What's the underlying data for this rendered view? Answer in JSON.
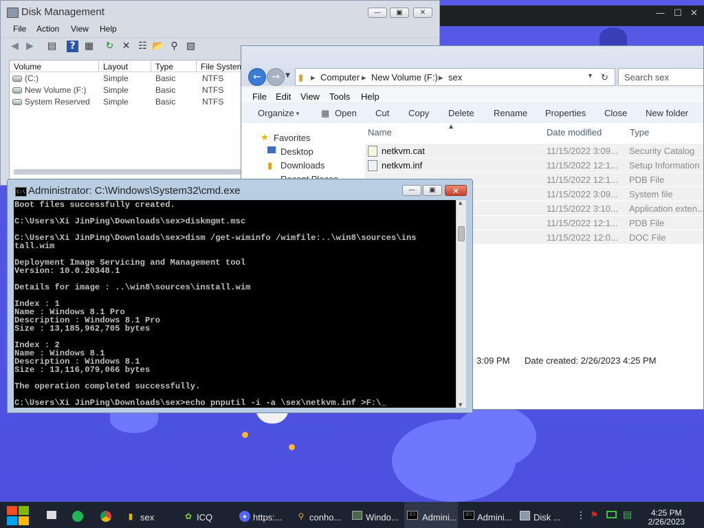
{
  "disk_management": {
    "title": "Disk Management",
    "menu": [
      "File",
      "Action",
      "View",
      "Help"
    ],
    "columns": [
      "Volume",
      "Layout",
      "Type",
      "File System"
    ],
    "volumes": [
      {
        "volume": "(C:)",
        "layout": "Simple",
        "type": "Basic",
        "fs": "NTFS"
      },
      {
        "volume": "New Volume (F:)",
        "layout": "Simple",
        "type": "Basic",
        "fs": "NTFS"
      },
      {
        "volume": "System Reserved",
        "layout": "Simple",
        "type": "Basic",
        "fs": "NTFS"
      }
    ],
    "toolbar_icons": [
      "back-icon",
      "forward-icon",
      "show-hide-icon",
      "help-icon",
      "properties-icon",
      "refresh-icon",
      "delete-icon",
      "properties-sheet-icon",
      "open-icon",
      "search-icon",
      "help-topics-icon"
    ]
  },
  "explorer": {
    "breadcrumb": [
      "Computer",
      "New Volume (F:)",
      "sex"
    ],
    "search_placeholder": "Search sex",
    "menu": [
      "File",
      "Edit",
      "View",
      "Tools",
      "Help"
    ],
    "commands": [
      "Organize",
      "Open",
      "Cut",
      "Copy",
      "Delete",
      "Rename",
      "Properties",
      "Close",
      "New folder"
    ],
    "nav": {
      "favorites": "Favorites",
      "items": [
        "Desktop",
        "Downloads",
        "Recent Places"
      ]
    },
    "columns": [
      "Name",
      "Date modified",
      "Type"
    ],
    "files": [
      {
        "name": "netkvm.cat",
        "date": "11/15/2022 3:09...",
        "type": "Security Catalog"
      },
      {
        "name": "netkvm.inf",
        "date": "11/15/2022 12:1...",
        "type": "Setup Information"
      },
      {
        "name": "",
        "date": "11/15/2022 12:1...",
        "type": "PDB File"
      },
      {
        "name": "",
        "date": "11/15/2022 3:09...",
        "type": "System file"
      },
      {
        "name": "",
        "date": "11/15/2022 3:10...",
        "type": "Application exten..."
      },
      {
        "name": "",
        "date": "11/15/2022 12:1...",
        "type": "PDB File"
      },
      {
        "name": "",
        "date": "11/15/2022 12:0...",
        "type": "DOC File"
      }
    ],
    "details_modified": "3:09 PM",
    "details_created": "Date created: 2/26/2023 4:25 PM"
  },
  "cmd": {
    "title": "Administrator: C:\\Windows\\System32\\cmd.exe",
    "output": "Boot files successfully created.\n\nC:\\Users\\Xi JinPing\\Downloads\\sex>diskmgmt.msc\n\nC:\\Users\\Xi JinPing\\Downloads\\sex>dism /get-wiminfo /wimfile:..\\win8\\sources\\ins\ntall.wim\n\nDeployment Image Servicing and Management tool\nVersion: 10.0.20348.1\n\nDetails for image : ..\\win8\\sources\\install.wim\n\nIndex : 1\nName : Windows 8.1 Pro\nDescription : Windows 8.1 Pro\nSize : 13,185,962,705 bytes\n\nIndex : 2\nName : Windows 8.1\nDescription : Windows 8.1\nSize : 13,116,079,066 bytes\n\nThe operation completed successfully.\n\nC:\\Users\\Xi JinPing\\Downloads\\sex>echo pnputil -i -a \\sex\\netkvm.inf >F:\\_"
  },
  "taskbar": {
    "items": [
      {
        "label": "sex",
        "icon": "folder-icon"
      },
      {
        "label": "ICQ",
        "icon": "icq-icon"
      },
      {
        "label": "https:...",
        "icon": "discord-icon"
      },
      {
        "label": "conho...",
        "icon": "search-icon"
      },
      {
        "label": "Windo...",
        "icon": "monitor-icon"
      },
      {
        "label": "Admini...",
        "icon": "cmd-icon"
      },
      {
        "label": "Admini...",
        "icon": "cmd-icon"
      },
      {
        "label": "Disk ...",
        "icon": "disk-icon"
      }
    ],
    "clock_time": "4:25 PM",
    "clock_date": "2/26/2023"
  },
  "colors": {
    "desktop": "#4f56e3",
    "console_bg": "#000000",
    "console_fg": "#c0c0c0",
    "taskbar": "#1b2331"
  }
}
